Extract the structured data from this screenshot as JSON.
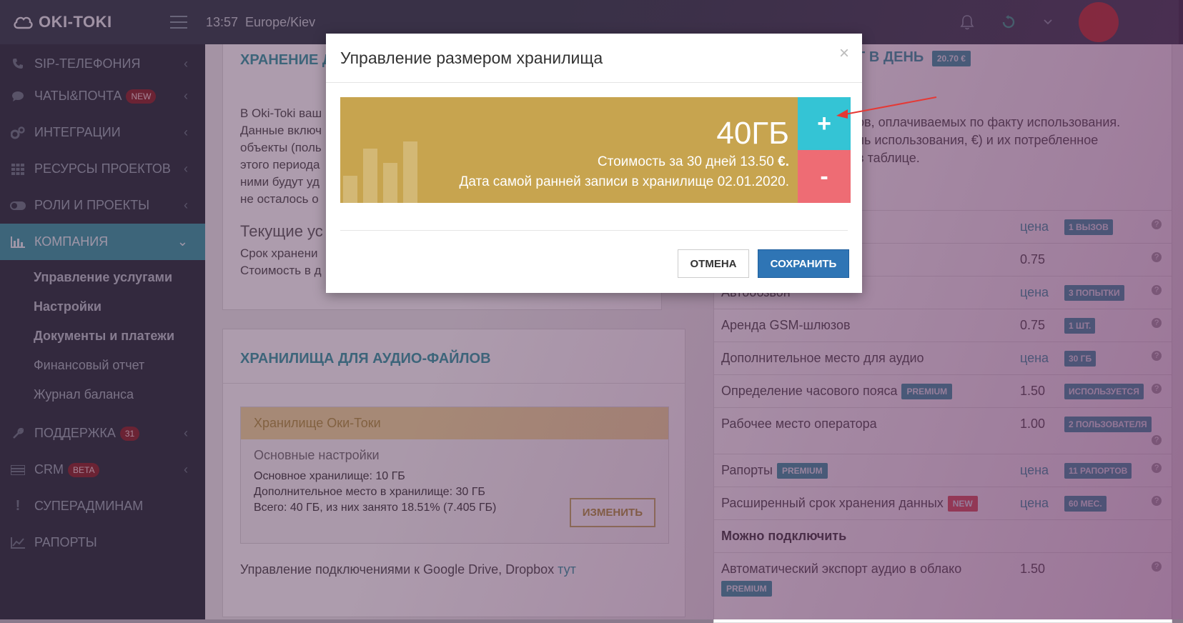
{
  "header": {
    "logo_text": "OKI-TOKI",
    "time": "13:57",
    "timezone": "Europe/Kiev"
  },
  "sidebar": {
    "items": [
      {
        "label": "SIP-ТЕЛЕФОНИЯ",
        "icon": "phone-icon"
      },
      {
        "label": "ЧАТЫ&ПОЧТА",
        "badge": "NEW",
        "icon": "chat-icon"
      },
      {
        "label": "ИНТЕГРАЦИИ",
        "icon": "gears-icon"
      },
      {
        "label": "РЕСУРСЫ ПРОЕКТОВ",
        "icon": "grid-icon"
      },
      {
        "label": "РОЛИ И ПРОЕКТЫ",
        "icon": "toggle-icon"
      },
      {
        "label": "КОМПАНИЯ",
        "icon": "bar-chart-icon",
        "active": true
      }
    ],
    "sub_items": [
      {
        "label": "Управление услугами",
        "bold": true
      },
      {
        "label": "Настройки",
        "bold": true
      },
      {
        "label": "Документы и платежи",
        "bold": true
      },
      {
        "label": "Финансовый отчет",
        "bold": false
      },
      {
        "label": "Журнал баланса",
        "bold": false
      }
    ],
    "bottom_items": [
      {
        "label": "ПОДДЕРЖКА",
        "badge": "31",
        "icon": "wrench-icon"
      },
      {
        "label": "CRM",
        "badge": "BETA",
        "icon": "crm-icon"
      },
      {
        "label": "СУПЕРАДМИНАМ",
        "icon": "exclamation-icon"
      },
      {
        "label": "РАПОРТЫ",
        "icon": "line-chart-icon"
      }
    ]
  },
  "left_panel": {
    "title_partial": "ХРАНЕНИЕ Д",
    "text_lines": [
      "В Oki-Toki ваш",
      "Данные включ",
      "объекты (поль",
      "этого периода",
      "ними будут уд",
      "не осталось о"
    ],
    "current_heading": "Текущие ус",
    "term_line": "Срок хранени",
    "cost_line": "Стоимость в д"
  },
  "audio_panel": {
    "title": "ХРАНИЛИЩА ДЛЯ АУДИО-ФАЙЛОВ",
    "box_title": "Хранилище Оки-Токи",
    "settings_title": "Основные настройки",
    "main_storage": "Основное хранилище: 10 ГБ",
    "extra_storage": "Дополнительное место в хранилище: 30 ГБ",
    "total": "Всего: 40 ГБ, из них занято 18.51% (7.405 ГБ)",
    "change_label": "ИЗМЕНИТЬ",
    "drive_text": "Управление подключениями к Google Drive, Dropbox",
    "drive_link": "тут"
  },
  "right_panel": {
    "title_partial": "Г В ДЕНЬ",
    "badge": "20.70 €",
    "desc_lines": [
      "ов, оплачиваемых по факту использования.",
      "нь использования, €) и их потребленное",
      "в таблице."
    ],
    "rows": [
      {
        "name": "",
        "price": "цена",
        "price_link": true,
        "pill": "1 ВЫЗОВ"
      },
      {
        "name": "",
        "price": "0.75",
        "price_link": false,
        "pill": ""
      },
      {
        "name": "Автообзвон",
        "price": "цена",
        "price_link": true,
        "pill": "3 ПОПЫТКИ"
      },
      {
        "name": "Аренда GSM-шлюзов",
        "price": "0.75",
        "price_link": false,
        "pill": "1 ШТ."
      },
      {
        "name": "Дополнительное место для аудио",
        "price": "цена",
        "price_link": true,
        "pill": "30 ГБ"
      },
      {
        "name": "Определение часового пояса",
        "tag": "PREMIUM",
        "price": "1.50",
        "price_link": false,
        "pill": "ИСПОЛЬЗУЕТСЯ"
      },
      {
        "name": "Рабочее место оператора",
        "price": "1.00",
        "price_link": false,
        "pill": "2 ПОЛЬЗОВАТЕЛЯ"
      },
      {
        "name": "Рапорты",
        "tag": "PREMIUM",
        "price": "цена",
        "price_link": true,
        "pill": "11 РАПОРТОВ"
      },
      {
        "name": "Расширенный срок хранения данных",
        "tag": "NEW",
        "tag_red": true,
        "price": "цена",
        "price_link": true,
        "pill": "60 МЕС."
      }
    ],
    "can_connect": "Можно подключить",
    "auto_export": "Автоматический экспорт аудио в облако",
    "auto_export_price": "1.50",
    "auto_export_tag": "PREMIUM"
  },
  "modal": {
    "title": "Управление размером хранилища",
    "size": "40ГБ",
    "cost_text": "Стоимость за 30 дней 13.50",
    "currency": "€.",
    "earliest": "Дата самой ранней записи в хранилище 02.01.2020.",
    "plus_label": "+",
    "minus_label": "-",
    "cancel_label": "ОТМЕНА",
    "save_label": "СОХРАНИТЬ",
    "close_symbol": "×"
  },
  "colors": {
    "accent": "#3fa0a8",
    "storage_bar": "#c7a44f",
    "plus": "#34c4d5",
    "minus": "#ee6c74",
    "save": "#2f75b5",
    "arrow": "#e53935"
  }
}
